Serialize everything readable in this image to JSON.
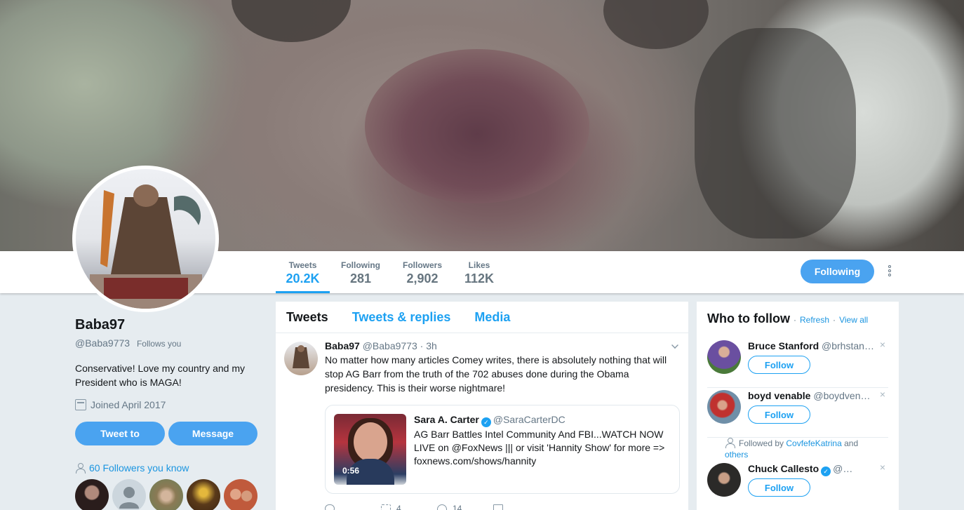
{
  "profile": {
    "name": "Baba97",
    "handle": "@Baba9773",
    "follows_you": "Follows you",
    "bio": "Conservative! Love my country and my President who is MAGA!",
    "joined": "Joined April 2017",
    "tweet_to": "Tweet to",
    "message": "Message",
    "followers_you_know": "60 Followers you know"
  },
  "nav": {
    "stats": [
      {
        "label": "Tweets",
        "value": "20.2K"
      },
      {
        "label": "Following",
        "value": "281"
      },
      {
        "label": "Followers",
        "value": "2,902"
      },
      {
        "label": "Likes",
        "value": "112K"
      }
    ],
    "follow_button": "Following"
  },
  "timeline": {
    "tabs": [
      "Tweets",
      "Tweets & replies",
      "Media"
    ],
    "tweet": {
      "name": "Baba97",
      "handle": "@Baba9773",
      "time": "· 3h",
      "text": "No matter how many articles Comey writes, there is absolutely nothing that will stop AG Barr from the truth of the 702 abuses done during the Obama presidency. This is their worse nightmare!",
      "card": {
        "name": "Sara A. Carter",
        "handle": "@SaraCarterDC",
        "text": "AG Barr Battles Intel Community And FBI...WATCH NOW LIVE on @FoxNews  |||  or visit 'Hannity Show' for more => foxnews.com/shows/hannity",
        "duration": "0:56"
      },
      "retweets": "4",
      "likes": "14"
    }
  },
  "who_to_follow": {
    "title": "Who to follow",
    "sep": "·",
    "refresh": "Refresh",
    "view_all": "View all",
    "follow_label": "Follow",
    "close": "×",
    "followed_by_prefix": "Followed by",
    "followed_by_user": "CovfefeKatrina",
    "and": "and",
    "others": "others",
    "suggestions": [
      {
        "name": "Bruce Stanford",
        "handle": "@brhstanford"
      },
      {
        "name": "boyd venable",
        "handle": "@boydvenable"
      },
      {
        "name": "Chuck Callesto",
        "handle": "@ChuckCallesto"
      }
    ]
  },
  "colors": {
    "accent": "#1da1f2",
    "button": "#4aa3f0",
    "background": "#e6ecf0"
  }
}
